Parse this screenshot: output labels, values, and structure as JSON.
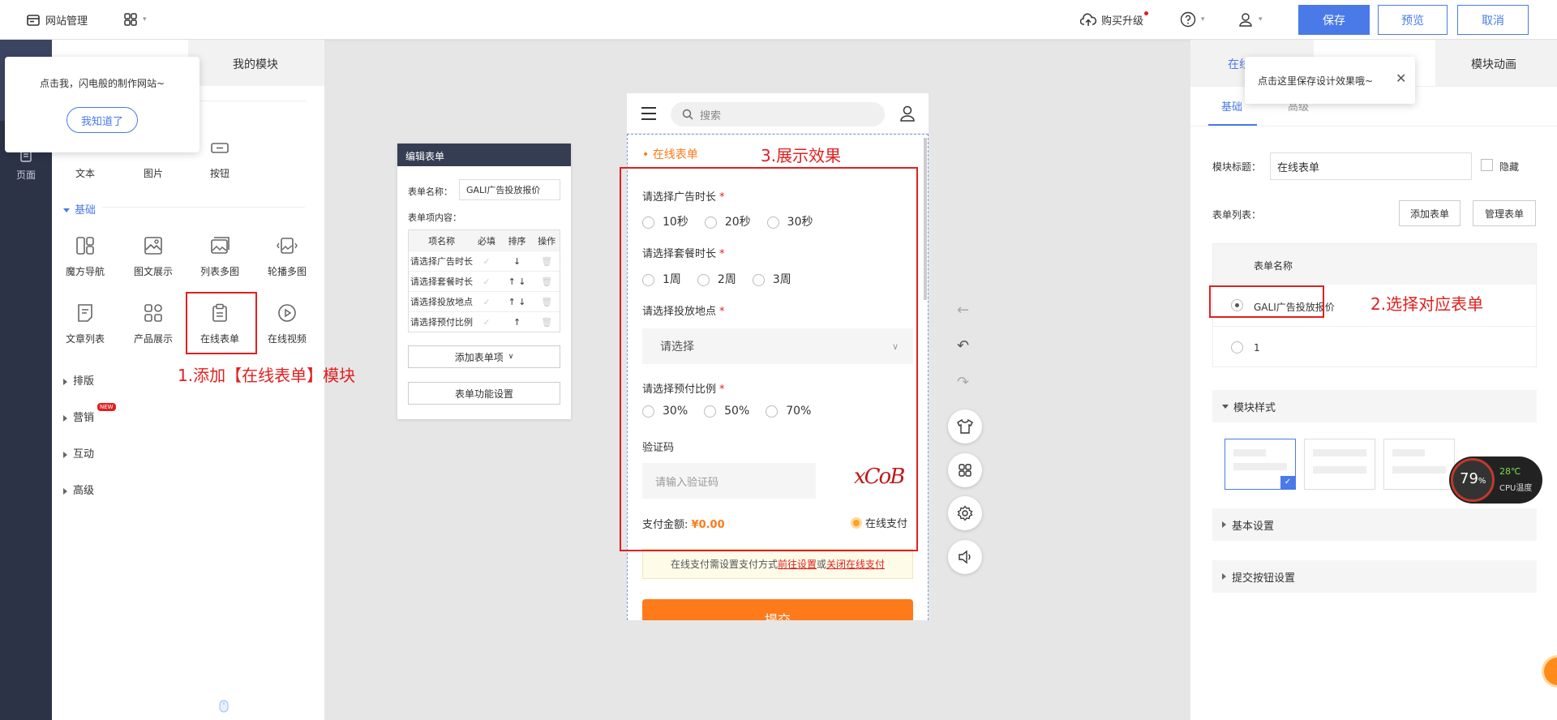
{
  "topbar": {
    "site_manage": "网站管理",
    "buy_upgrade": "购买升级",
    "save": "保存",
    "preview": "预览",
    "cancel": "取消"
  },
  "rail": {
    "pages": "页面"
  },
  "left_panel": {
    "tab_my_modules": "我的模块",
    "tooltip_text": "点击我，闪电般的制作网站~",
    "tooltip_ok": "我知道了",
    "row1": [
      "文本",
      "图片",
      "按钮"
    ],
    "group_basic": "基础",
    "basic_items": [
      "魔方导航",
      "图文展示",
      "列表多图",
      "轮播多图",
      "文章列表",
      "产品展示",
      "在线表单",
      "在线视频"
    ],
    "groups": [
      "排版",
      "营销",
      "互动",
      "高级"
    ],
    "new_badge": "NEW"
  },
  "annotations": {
    "step1": "1.添加【在线表单】模块",
    "step2": "2.选择对应表单",
    "step3": "3.展示效果"
  },
  "edit_form": {
    "header": "编辑表单",
    "name_label": "表单名称：",
    "name_value": "GALI广告投放报价",
    "items_label": "表单项内容：",
    "columns": [
      "项名称",
      "必填",
      "排序",
      "操作"
    ],
    "rows": [
      {
        "name": "请选择广告时长",
        "sort": "↓"
      },
      {
        "name": "请选择套餐时长",
        "sort": "↑ ↓"
      },
      {
        "name": "请选择投放地点",
        "sort": "↑ ↓"
      },
      {
        "name": "请选择预付比例",
        "sort": "↑"
      }
    ],
    "add_item": "添加表单项",
    "settings": "表单功能设置"
  },
  "phone": {
    "search_placeholder": "搜索",
    "form_title": "在线表单",
    "q1_label": "请选择广告时长",
    "q1_options": [
      "10秒",
      "20秒",
      "30秒"
    ],
    "q2_label": "请选择套餐时长",
    "q2_options": [
      "1周",
      "2周",
      "3周"
    ],
    "q3_label": "请选择投放地点",
    "q3_placeholder": "请选择",
    "q4_label": "请选择预付比例",
    "q4_options": [
      "30%",
      "50%",
      "70%"
    ],
    "captcha_label": "验证码",
    "captcha_placeholder": "请输入验证码",
    "captcha_text": "xCoB",
    "pay_label": "支付金额:",
    "pay_amount": "¥0.00",
    "online_pay": "在线支付",
    "notice_pre": "在线支付需设置支付方式",
    "notice_link1": "前往设置",
    "notice_mid": "或",
    "notice_link2": "关闭在线支付",
    "submit": "提交"
  },
  "right_panel": {
    "tab_online": "在线",
    "tab_anim": "模块动画",
    "subtab_basic": "基础",
    "subtab_adv": "高级",
    "tooltip_text": "点击这里保存设计效果哦~",
    "title_label": "模块标题：",
    "title_value": "在线表单",
    "hide_label": "隐藏",
    "list_label": "表单列表：",
    "add_form": "添加表单",
    "manage_form": "管理表单",
    "col_name": "表单名称",
    "forms": [
      "GALI广告投放报价",
      "1"
    ],
    "style_section": "模块样式",
    "basic_settings": "基本设置",
    "submit_settings": "提交按钮设置"
  },
  "cpu": {
    "percent": "79",
    "unit": "%",
    "temp": "28℃",
    "label": "CPU温度"
  },
  "colors": {
    "accent": "#4a7ae8",
    "annotation": "#e02020",
    "submit": "#ff7a1a",
    "rail": "#2d3347"
  }
}
